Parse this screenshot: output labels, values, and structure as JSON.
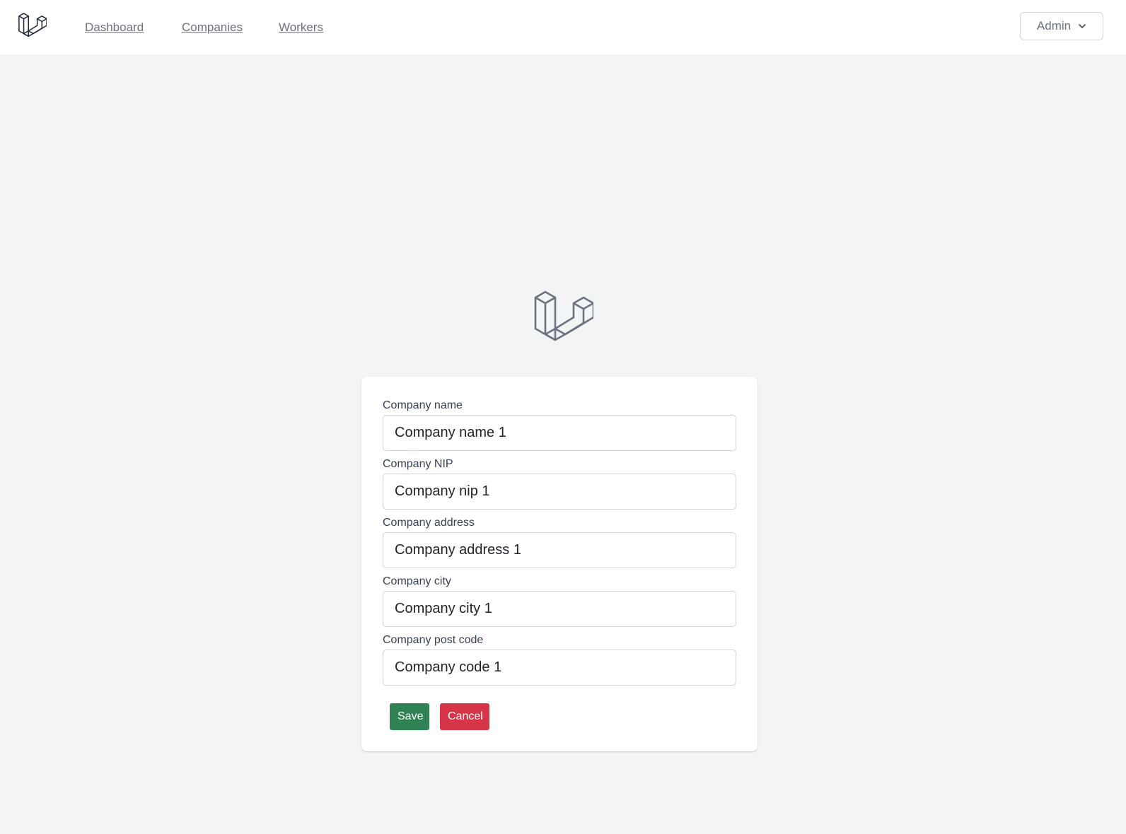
{
  "nav": {
    "links": [
      {
        "label": "Dashboard"
      },
      {
        "label": "Companies"
      },
      {
        "label": "Workers"
      }
    ],
    "user_menu": {
      "label": "Admin",
      "icon": "chevron-down-icon"
    },
    "logo_icon": "laravel-logo-icon"
  },
  "form": {
    "logo_icon": "laravel-logo-icon",
    "fields": [
      {
        "label": "Company name",
        "value": "Company name 1"
      },
      {
        "label": "Company NIP",
        "value": "Company nip 1"
      },
      {
        "label": "Company address",
        "value": "Company address 1"
      },
      {
        "label": "Company city",
        "value": "Company city 1"
      },
      {
        "label": "Company post code",
        "value": "Company code 1"
      }
    ],
    "save_label": "Save",
    "cancel_label": "Cancel"
  },
  "colors": {
    "page_bg": "#f3f4f6",
    "save": "#2f8253",
    "cancel": "#d63548",
    "logo_stroke": "#6b7280"
  }
}
